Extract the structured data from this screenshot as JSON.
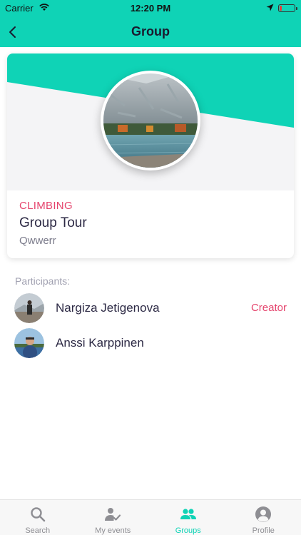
{
  "status_bar": {
    "carrier": "Carrier",
    "time": "12:20 PM",
    "battery_level": 0.15
  },
  "nav": {
    "title": "Group",
    "back_icon": "chevron-left-icon"
  },
  "group": {
    "category": "CLIMBING",
    "name": "Group Tour",
    "description": "Qwwerr"
  },
  "participants": {
    "label": "Participants:",
    "items": [
      {
        "name": "Nargiza Jetigenova",
        "role": "Creator"
      },
      {
        "name": "Anssi Karppinen",
        "role": ""
      }
    ]
  },
  "tabs": [
    {
      "label": "Search",
      "icon": "search-icon",
      "active": false
    },
    {
      "label": "My events",
      "icon": "user-check-icon",
      "active": false
    },
    {
      "label": "Groups",
      "icon": "group-icon",
      "active": true
    },
    {
      "label": "Profile",
      "icon": "profile-icon",
      "active": false
    }
  ],
  "colors": {
    "accent": "#0fd3b6",
    "highlight": "#e5446d",
    "text": "#2d2a45",
    "muted": "#a0a0b0"
  }
}
